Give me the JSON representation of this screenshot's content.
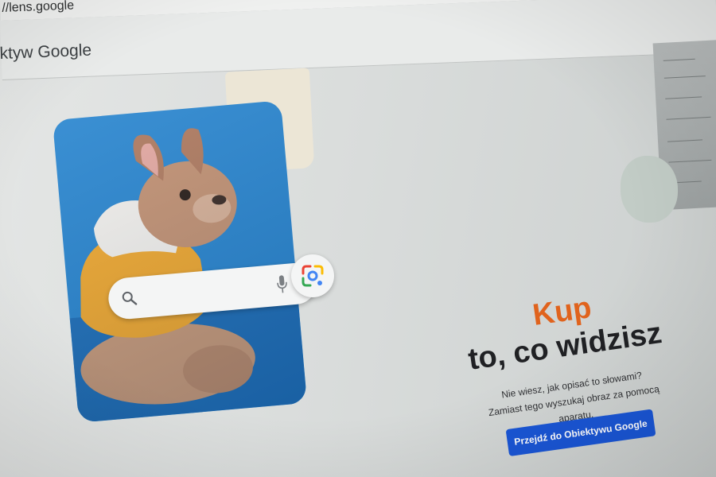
{
  "browser": {
    "url": "//lens.google"
  },
  "header": {
    "brand": "ktyw Google"
  },
  "search": {
    "search_icon": "search-icon",
    "mic_icon": "mic-icon",
    "lens_icon": "google-lens-icon"
  },
  "hero": {
    "title_accent": "Kup",
    "title_main": "to, co widzisz",
    "description_line1": "Nie wiesz, jak opisać to słowami?",
    "description_line2": "Zamiast tego wyszukaj obraz za pomocą aparatu.",
    "cta_label": "Przejdź do Obiektywu Google"
  },
  "colors": {
    "accent_orange": "#e0631d",
    "cta_blue": "#1a56d6",
    "photo_blue": "#2a86cf"
  }
}
